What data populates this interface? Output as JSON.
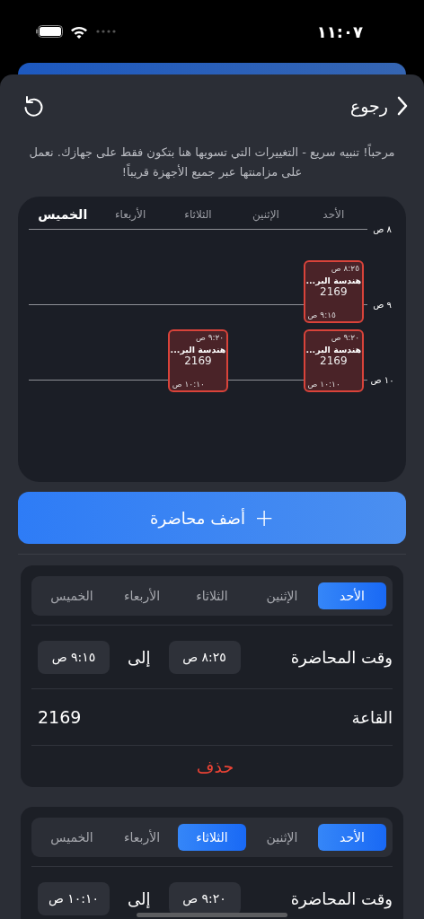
{
  "status_bar": {
    "time": "١١:٠٧"
  },
  "header": {
    "back_label": "رجوع"
  },
  "notice": "مرحباً! تنبيه سريع - التغييرات التي تسويها هنا بتكون فقط على جهازك. نعمل على مزامنتها عبر جميع الأجهزة قريباً!",
  "schedule": {
    "hours": [
      "٨ ص",
      "٩ ص",
      "١٠ ص"
    ],
    "days": [
      {
        "label": "الأحد",
        "selected": false,
        "events": [
          {
            "start": "٨:٢٥ ص",
            "end": "٩:١٥ ص",
            "title": "هندسة البر...",
            "room": "2169"
          },
          {
            "start": "٩:٢٠ ص",
            "end": "١٠:١٠ ص",
            "title": "هندسة البر...",
            "room": "2169"
          }
        ]
      },
      {
        "label": "الإثنين",
        "selected": false
      },
      {
        "label": "الثلاثاء",
        "selected": false,
        "events": [
          {
            "start": "٩:٢٠ ص",
            "end": "١٠:١٠ ص",
            "title": "هندسة البر...",
            "room": "2169"
          }
        ]
      },
      {
        "label": "الأربعاء",
        "selected": false
      },
      {
        "label": "الخميس",
        "selected": true
      }
    ]
  },
  "add_button": {
    "label": "أضف محاضرة",
    "icon": "+"
  },
  "lectures": [
    {
      "days": [
        {
          "label": "الأحد",
          "selected": true
        },
        {
          "label": "الإثنين",
          "selected": false
        },
        {
          "label": "الثلاثاء",
          "selected": false
        },
        {
          "label": "الأربعاء",
          "selected": false
        },
        {
          "label": "الخميس",
          "selected": false
        }
      ],
      "time_label": "وقت المحاضرة",
      "start": "٨:٢٥ ص",
      "to_label": "إلى",
      "end": "٩:١٥ ص",
      "room_label": "القاعة",
      "room": "2169",
      "delete_label": "حذف"
    },
    {
      "days": [
        {
          "label": "الأحد",
          "selected": true
        },
        {
          "label": "الإثنين",
          "selected": false
        },
        {
          "label": "الثلاثاء",
          "selected": true
        },
        {
          "label": "الأربعاء",
          "selected": false
        },
        {
          "label": "الخميس",
          "selected": false
        }
      ],
      "time_label": "وقت المحاضرة",
      "start": "٩:٢٠ ص",
      "to_label": "إلى",
      "end": "١٠:١٠ ص"
    }
  ]
}
